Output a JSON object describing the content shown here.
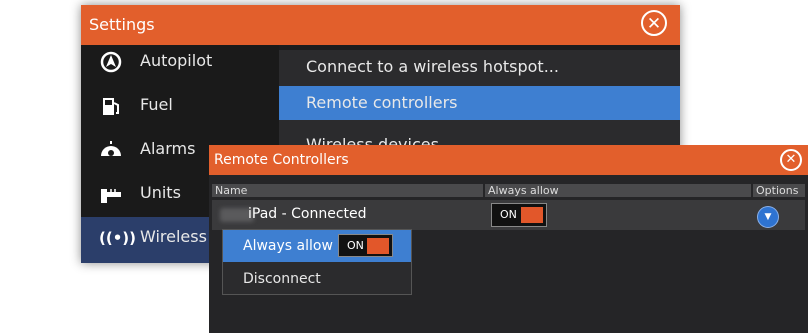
{
  "settings": {
    "title": "Settings",
    "sidebar": [
      {
        "label": "Autopilot",
        "icon": "autopilot-icon"
      },
      {
        "label": "Fuel",
        "icon": "fuel-icon"
      },
      {
        "label": "Alarms",
        "icon": "alarm-icon"
      },
      {
        "label": "Units",
        "icon": "units-icon"
      },
      {
        "label": "Wireless",
        "icon": "wireless-icon",
        "selected": true
      }
    ],
    "submenu": [
      {
        "label": "Connect to a wireless hotspot..."
      },
      {
        "label": "Remote controllers",
        "selected": true
      },
      {
        "label": "Wireless devices"
      }
    ]
  },
  "remote_controllers": {
    "title": "Remote Controllers",
    "columns": [
      "Name",
      "Always allow",
      "Options"
    ],
    "rows": [
      {
        "name": "iPad - Connected",
        "always_allow": "ON"
      }
    ]
  },
  "popup": {
    "items": [
      {
        "label": "Always allow",
        "toggle": "ON"
      },
      {
        "label": "Disconnect"
      }
    ]
  },
  "colors": {
    "header": "#e25f2c",
    "selected": "#3e7fd1",
    "sidebar_selected": "#2b3e6a",
    "toggle_knob": "#e2572a"
  }
}
